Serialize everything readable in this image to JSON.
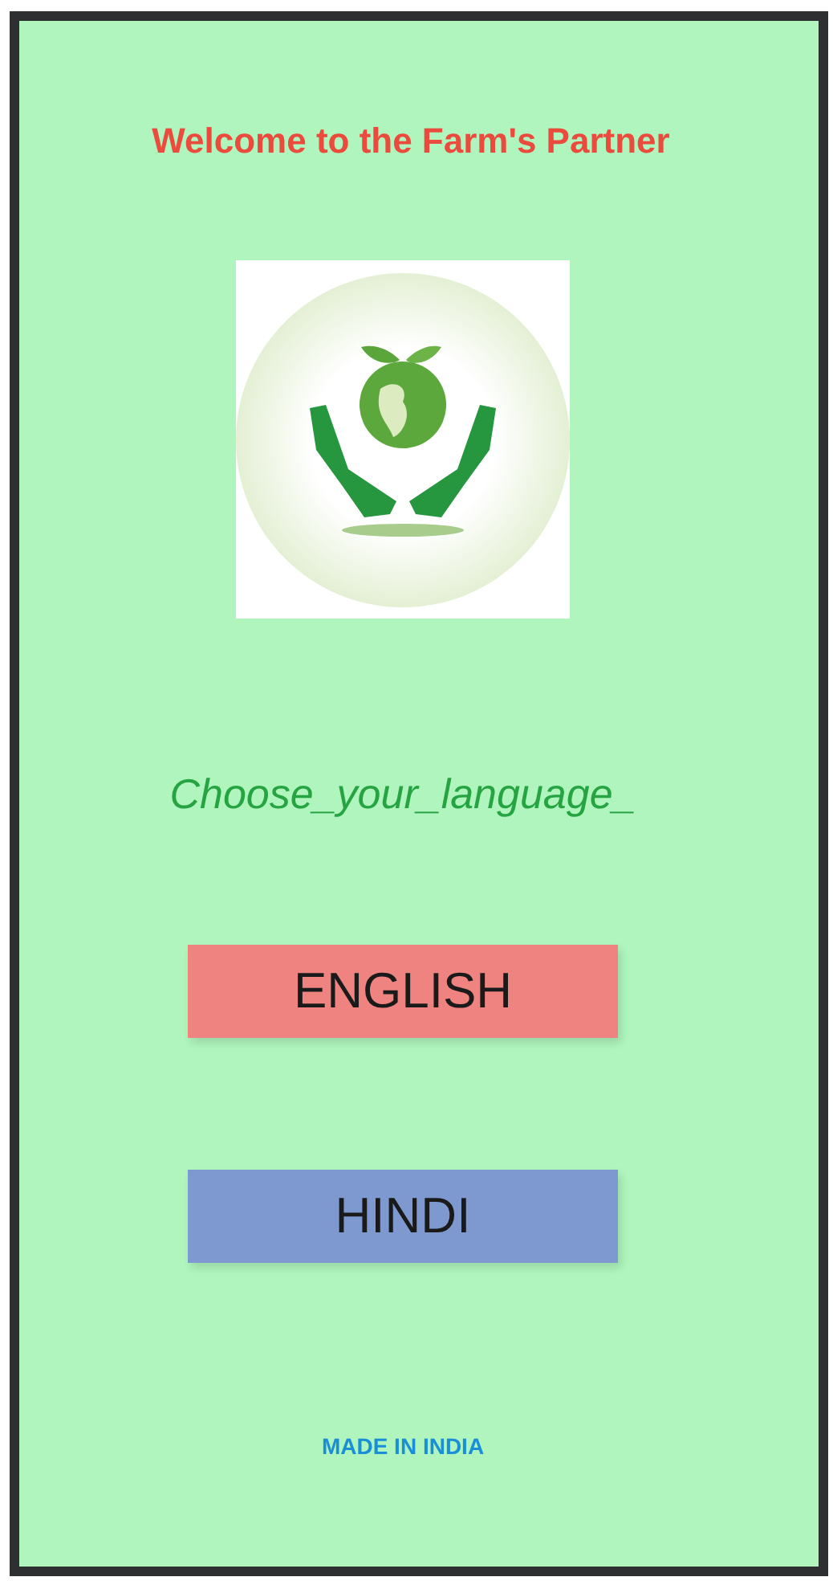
{
  "title": "Welcome to the Farm's Partner",
  "prompt": "Choose_your_language_",
  "languages": [
    {
      "label": "ENGLISH",
      "color": "#ef8380"
    },
    {
      "label": "HINDI",
      "color": "#7d99cf"
    }
  ],
  "footer": "MADE IN INDIA"
}
